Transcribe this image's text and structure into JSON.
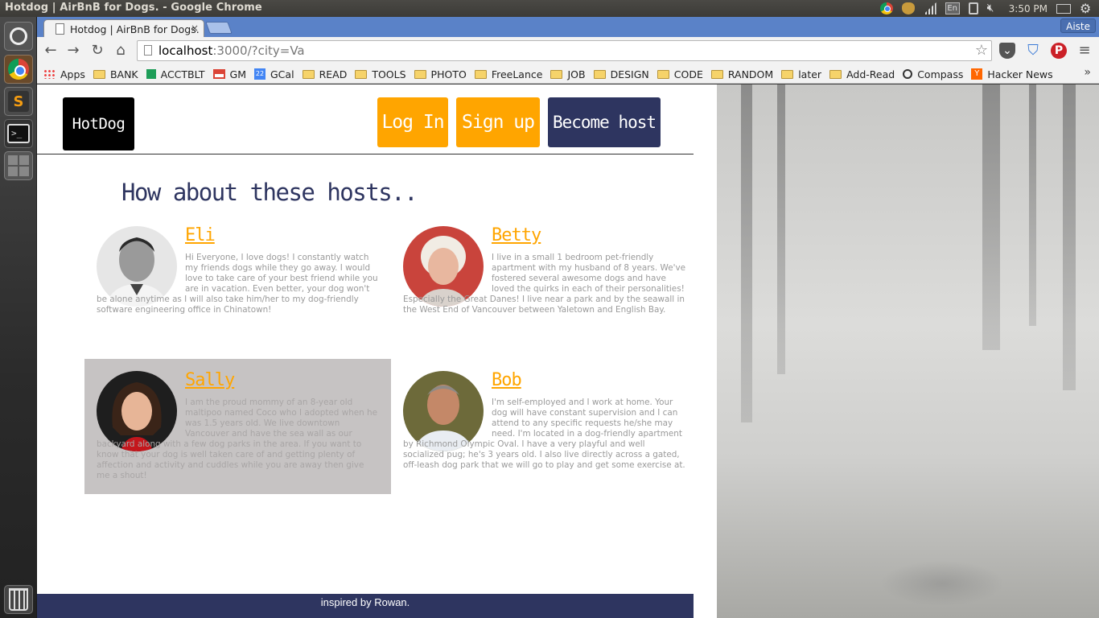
{
  "os": {
    "window_title": "Hotdog | AirBnB for Dogs. - Google Chrome",
    "clock": "3:50 PM",
    "keyboard": "En"
  },
  "browser": {
    "tab_title": "Hotdog | AirBnB for Dogs.",
    "tab_close": "×",
    "user": "Aiste",
    "url_host": "localhost",
    "url_rest": ":3000/?city=Va",
    "bookmarks": [
      "Apps",
      "BANK",
      "ACCTBLT",
      "GM",
      "GCal",
      "READ",
      "TOOLS",
      "PHOTO",
      "FreeLance",
      "JOB",
      "DESIGN",
      "CODE",
      "RANDOM",
      "later",
      "Add-Read",
      "Compass",
      "Hacker News"
    ],
    "bookmark_icons": [
      "apps-icon",
      "folder-icon",
      "sheets-icon",
      "gmail-icon",
      "calendar-icon",
      "folder-icon",
      "folder-icon",
      "folder-icon",
      "folder-icon",
      "folder-icon",
      "folder-icon",
      "folder-icon",
      "folder-icon",
      "folder-icon",
      "folder-icon",
      "compass-icon",
      "hacker-news-icon"
    ],
    "gcal_badge": "22",
    "more": "»"
  },
  "site": {
    "logo": "HotDog",
    "login": "Log In",
    "signup": "Sign up",
    "become_host": "Become host",
    "heading": "How about these hosts..",
    "hosts": [
      {
        "name": "Eli",
        "desc": "Hi Everyone, I love dogs! I constantly watch my friends dogs while they go away. I would love to take care of your best friend while you are in vacation. Even better, your dog won't be alone anytime as I will also take him/her to my dog-friendly software engineering office in Chinatown!"
      },
      {
        "name": "Betty",
        "desc": "I live in a small 1 bedroom pet-friendly apartment with my husband of 8 years. We've fostered several awesome dogs and have loved the quirks in each of their personalities! Especially the Great Danes! I live near a park and by the seawall in the West End of Vancouver between Yaletown and English Bay."
      },
      {
        "name": "Sally",
        "desc": "I am the proud mommy of an 8-year old maltipoo named Coco who I adopted when he was 1.5 years old. We live downtown Vancouver and have the sea wall as our backyard along with a few dog parks in the area. If you want to know that your dog is well taken care of and getting plenty of affection and activity and cuddles while you are away then give me a shout!"
      },
      {
        "name": "Bob",
        "desc": "I'm self-employed and I work at home. Your dog will have constant supervision and I can attend to any specific requests he/she may need. I'm located in a dog-friendly apartment by Richmond Olympic Oval. I have a very playful and well socialized pug; he's 3 years old. I also live directly across a gated, off-leash dog park that we will go to play and get some exercise at."
      }
    ],
    "footer": "inspired by Rowan.",
    "colors": {
      "orange": "#ffa500",
      "navy": "#2e3560",
      "logo_bg": "#000000",
      "highlight_card": "#c6c3c3"
    }
  }
}
